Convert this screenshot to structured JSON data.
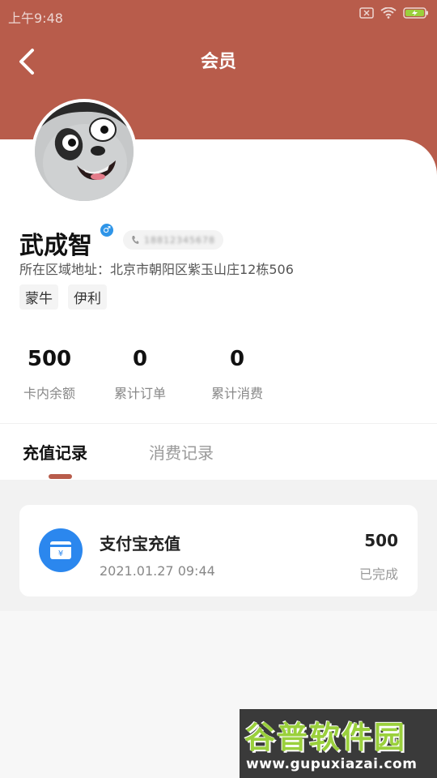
{
  "status_bar": {
    "time": "上午9:48"
  },
  "nav": {
    "title": "会员"
  },
  "profile": {
    "name": "武成智",
    "gender_symbol": "♂",
    "phone_masked": "18812345678",
    "address": "所在区域地址：北京市朝阳区紫玉山庄12栋506",
    "tags": [
      "蒙牛",
      "伊利"
    ]
  },
  "stats": [
    {
      "value": "500",
      "label": "卡内余额"
    },
    {
      "value": "0",
      "label": "累计订单"
    },
    {
      "value": "0",
      "label": "累计消费"
    }
  ],
  "tabs": [
    {
      "label": "充值记录",
      "active": true
    },
    {
      "label": "消费记录",
      "active": false
    }
  ],
  "records": [
    {
      "icon": "wallet-yuan-icon",
      "title": "支付宝充值",
      "time": "2021.01.27 09:44",
      "amount": "500",
      "status": "已完成"
    }
  ],
  "watermark": {
    "logo_text": "谷普软件园",
    "url": "www.gupuxiazai.com"
  },
  "colors": {
    "brand": "#b85c4b",
    "record_icon_bg": "#2b87ee",
    "gender_badge": "#2f95e8"
  }
}
